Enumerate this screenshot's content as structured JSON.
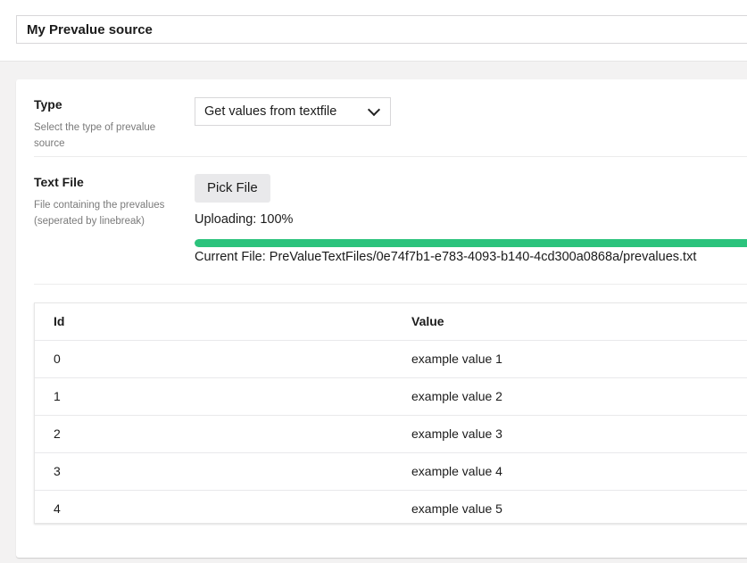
{
  "header": {
    "name_value": "My Prevalue source"
  },
  "type_property": {
    "label": "Type",
    "description": "Select the type of prevalue source",
    "selected_option": "Get values from textfile"
  },
  "file_property": {
    "label": "Text File",
    "description": "File containing the prevalues (seperated by linebreak)",
    "pick_button_label": "Pick File",
    "upload_status": "Uploading: 100%",
    "upload_progress_percent": 100,
    "progress_color": "#2bc37c",
    "current_file": "Current File: PreValueTextFiles/0e74f7b1-e783-4093-b140-4cd300a0868a/prevalues.txt"
  },
  "values_table": {
    "headers": [
      "Id",
      "Value"
    ],
    "rows": [
      {
        "id": "0",
        "value": "example value 1"
      },
      {
        "id": "1",
        "value": "example value 2"
      },
      {
        "id": "2",
        "value": "example value 3"
      },
      {
        "id": "3",
        "value": "example value 4"
      },
      {
        "id": "4",
        "value": "example value 5"
      }
    ]
  }
}
